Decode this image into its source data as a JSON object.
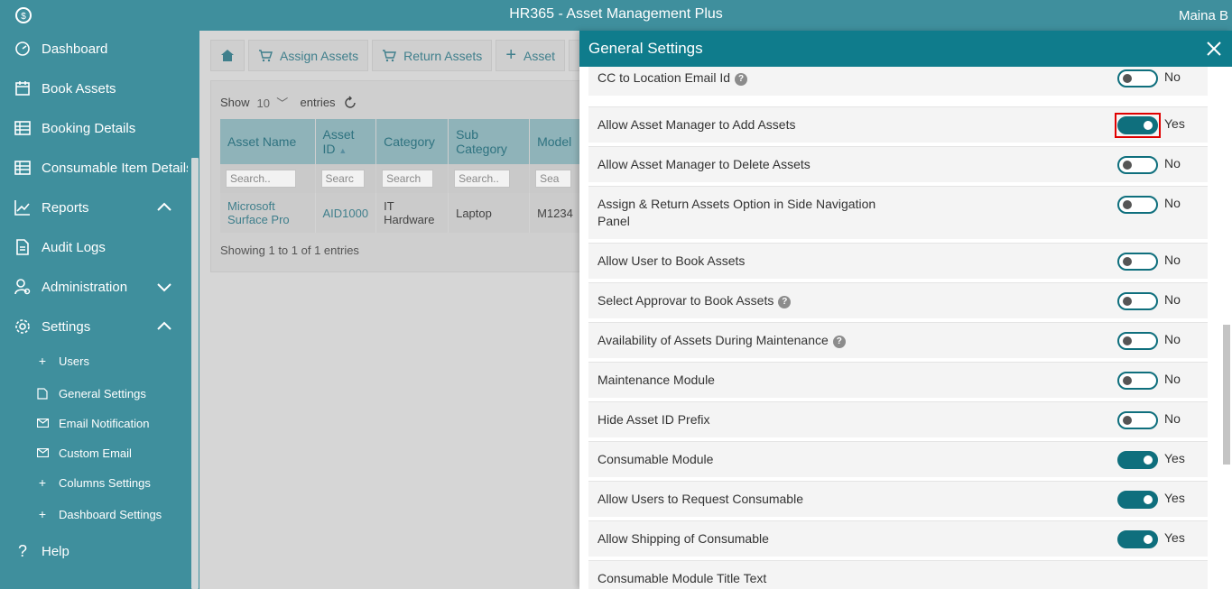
{
  "app": {
    "title": "HR365 - Asset Management Plus",
    "user": "Maina B"
  },
  "sidebar": {
    "items": [
      {
        "label": "Dashboard",
        "icon": "dashboard-gauge-icon"
      },
      {
        "label": "Book Assets",
        "icon": "calendar-icon"
      },
      {
        "label": "Booking Details",
        "icon": "table-icon"
      },
      {
        "label": "Consumable Item Details",
        "icon": "table-icon"
      },
      {
        "label": "Reports",
        "icon": "line-chart-icon",
        "expanded": true
      },
      {
        "label": "Audit Logs",
        "icon": "document-icon"
      },
      {
        "label": "Administration",
        "icon": "user-gear-icon",
        "expanded": false
      },
      {
        "label": "Settings",
        "icon": "gear-icon",
        "expanded": true
      }
    ],
    "sub_items": [
      {
        "label": "Users",
        "icon": "plus-icon"
      },
      {
        "label": "General Settings",
        "icon": "document-icon"
      },
      {
        "label": "Email Notification",
        "icon": "mail-icon"
      },
      {
        "label": "Custom Email",
        "icon": "mail-icon"
      },
      {
        "label": "Columns Settings",
        "icon": "plus-icon"
      },
      {
        "label": "Dashboard Settings",
        "icon": "plus-icon"
      }
    ],
    "help": "Help"
  },
  "toolbar": {
    "assign": "Assign Assets",
    "return": "Return Assets",
    "asset": "Asset"
  },
  "table": {
    "show_label": "Show",
    "entries_value": "10",
    "entries_label": "entries",
    "columns": [
      "Asset Name",
      "Asset ID",
      "Category",
      "Sub Category",
      "Model"
    ],
    "filters": [
      "Search..",
      "Searc",
      "Search",
      "Search..",
      "Sea"
    ],
    "rows": [
      [
        "Microsoft Surface Pro",
        "AID1000",
        "IT Hardware",
        "Laptop",
        "M1234"
      ]
    ],
    "showing": "Showing 1 to 1 of 1 entries"
  },
  "general_settings": {
    "title": "General Settings",
    "settings": [
      {
        "label": "CC to Location Email Id",
        "help": true,
        "on": false,
        "value": "No"
      },
      {
        "label": "Allow Asset Manager to Add Assets",
        "help": false,
        "on": true,
        "value": "Yes",
        "highlighted": true
      },
      {
        "label": "Allow Asset Manager to Delete Assets",
        "help": false,
        "on": false,
        "value": "No"
      },
      {
        "label": "Assign & Return Assets Option in Side Navigation Panel",
        "help": false,
        "on": false,
        "value": "No"
      },
      {
        "label": "Allow User to Book Assets",
        "help": false,
        "on": false,
        "value": "No"
      },
      {
        "label": "Select Approvar to Book Assets",
        "help": true,
        "on": false,
        "value": "No"
      },
      {
        "label": "Availability of Assets During Maintenance",
        "help": true,
        "on": false,
        "value": "No"
      },
      {
        "label": "Maintenance Module",
        "help": false,
        "on": false,
        "value": "No"
      },
      {
        "label": "Hide Asset ID Prefix",
        "help": false,
        "on": false,
        "value": "No"
      },
      {
        "label": "Consumable Module",
        "help": false,
        "on": true,
        "value": "Yes"
      },
      {
        "label": "Allow Users to Request Consumable",
        "help": false,
        "on": true,
        "value": "Yes"
      },
      {
        "label": "Allow Shipping of Consumable",
        "help": false,
        "on": true,
        "value": "Yes"
      },
      {
        "label": "Consumable Module Title Text",
        "help": false,
        "on": null,
        "value": ""
      }
    ]
  },
  "colors": {
    "sidebar": "#3f8f9d",
    "header": "#0f7c8c",
    "toggle": "#0f6f7d",
    "highlight": "#e00000"
  }
}
